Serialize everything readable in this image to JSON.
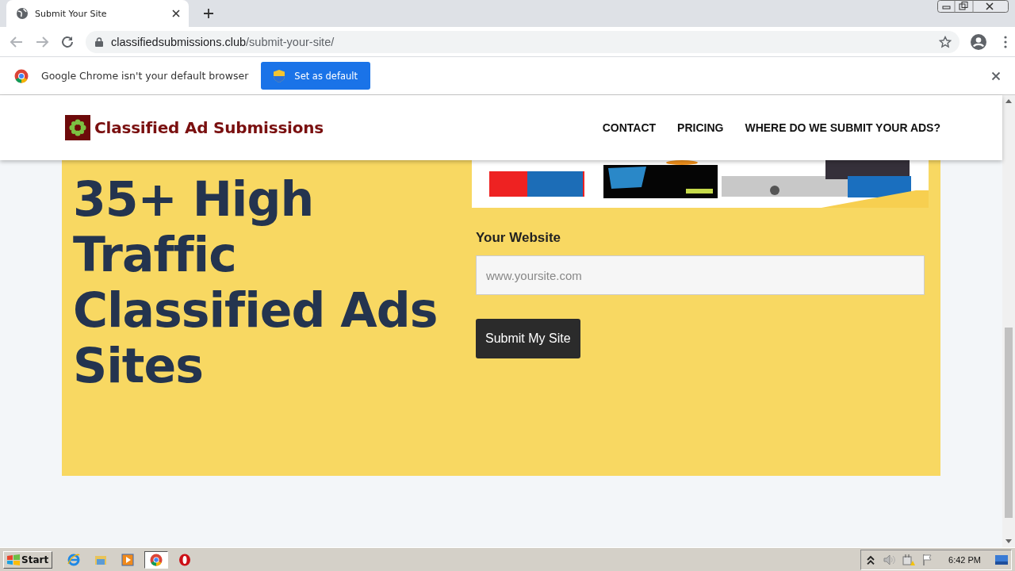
{
  "browser": {
    "tab": {
      "title": "Submit Your Site",
      "selected": true
    },
    "url": {
      "host": "classifiedsubmissions.club",
      "path": "/submit-your-site/"
    }
  },
  "infobar": {
    "message": "Google Chrome isn't your default browser",
    "button": "Set as default"
  },
  "site": {
    "logo": "Classified Ad Submissions",
    "nav": [
      "CONTACT",
      "PRICING",
      "WHERE DO WE SUBMIT YOUR ADS?"
    ]
  },
  "hero": {
    "heading": "35+ High Traffic Classified Ads Sites",
    "form": {
      "label": "Your Website",
      "placeholder": "www.yoursite.com",
      "submit": "Submit My Site"
    }
  },
  "taskbar": {
    "start": "Start",
    "apps": [
      {
        "kind": "ie",
        "selected": false
      },
      {
        "kind": "folder",
        "selected": false
      },
      {
        "kind": "media",
        "selected": false
      },
      {
        "kind": "chrome",
        "selected": true
      },
      {
        "kind": "opera",
        "selected": false
      }
    ],
    "clock": "6:42 PM"
  }
}
